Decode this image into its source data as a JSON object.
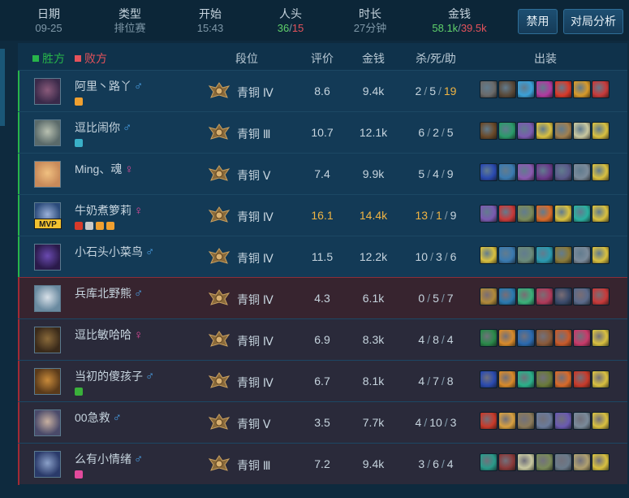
{
  "summary": {
    "date": {
      "label": "日期",
      "value": "09-25"
    },
    "type": {
      "label": "类型",
      "value": "排位赛"
    },
    "start": {
      "label": "开始",
      "value": "15:43"
    },
    "kills": {
      "label": "人头",
      "win": "36",
      "sep": "/",
      "lose": "15"
    },
    "duration": {
      "label": "时长",
      "value": "27分钟"
    },
    "gold": {
      "label": "金钱",
      "win": "58.1k",
      "sep": "/",
      "lose": "39.5k"
    }
  },
  "buttons": {
    "ban": "禁用",
    "analysis": "对局分析"
  },
  "table": {
    "win_label": "胜方",
    "lose_label": "败方",
    "headers": {
      "rank": "段位",
      "score": "评价",
      "gold": "金钱",
      "kda": "杀/死/助",
      "items": "出装"
    }
  },
  "colors": {
    "win": "#27b44a",
    "lose": "#e5525b",
    "highlight": "#f0b443",
    "male": "#4ba3ea",
    "female": "#e24a9c"
  },
  "players": [
    {
      "team": "win",
      "name": "阿里丶路丫",
      "gender": "♂",
      "rank": "青铜 Ⅳ",
      "score": "8.6",
      "gold": "9.4k",
      "k": "2",
      "d": "5",
      "a": "19",
      "hl": {
        "a": true
      },
      "mvp": false,
      "badges": [
        "#f0a030"
      ],
      "face": [
        "#3a2a4a",
        "#8a5a7a"
      ],
      "items": [
        "#6a6a6a",
        "#5a4a3a",
        "#3aa0d8",
        "#b03aa0",
        "#d83a2a",
        "#d89a2a",
        "#c83a3a"
      ]
    },
    {
      "team": "win",
      "name": "逗比闹你",
      "gender": "♂",
      "rank": "青铜 Ⅲ",
      "score": "10.7",
      "gold": "12.1k",
      "k": "6",
      "d": "2",
      "a": "5",
      "hl": {},
      "mvp": false,
      "badges": [
        "#3ab0c8"
      ],
      "face": [
        "#5a6a6a",
        "#b8c0b0"
      ],
      "items": [
        "#6a4a2a",
        "#2a9a6a",
        "#7a5ab0",
        "#d8c040",
        "#a08050",
        "#c8c8a0",
        "#d8c040"
      ]
    },
    {
      "team": "win",
      "name": "Ming、魂",
      "gender": "♀",
      "rank": "青铜 Ⅴ",
      "score": "7.4",
      "gold": "9.9k",
      "k": "5",
      "d": "4",
      "a": "9",
      "hl": {},
      "mvp": false,
      "badges": [],
      "face": [
        "#c88a5a",
        "#f0c080"
      ],
      "items": [
        "#2a4ab0",
        "#3a7ab0",
        "#8a5ab0",
        "#6a3a8a",
        "#5a5a8a",
        "#7a8a9a",
        "#d8c040"
      ]
    },
    {
      "team": "win",
      "name": "牛奶煮箩莉",
      "gender": "♀",
      "rank": "青铜 Ⅳ",
      "score": "16.1",
      "gold": "14.4k",
      "k": "13",
      "d": "1",
      "a": "9",
      "hl": {
        "score": true,
        "gold": true,
        "k": true,
        "d": true
      },
      "mvp": true,
      "badges": [
        "#d83a2a",
        "#c8c8c8",
        "#f0a030",
        "#f0a030"
      ],
      "face": [
        "#2a4a7a",
        "#9ab0d8"
      ],
      "items": [
        "#7a5ab0",
        "#c83a3a",
        "#7a8a5a",
        "#d86a2a",
        "#d8c040",
        "#2ab0a0",
        "#d8c040"
      ]
    },
    {
      "team": "win",
      "name": "小石头小菜鸟",
      "gender": "♂",
      "rank": "青铜 Ⅳ",
      "score": "11.5",
      "gold": "12.2k",
      "k": "10",
      "d": "3",
      "a": "6",
      "hl": {},
      "mvp": false,
      "badges": [],
      "face": [
        "#2a1a4a",
        "#6a4ab0"
      ],
      "items": [
        "#d8c040",
        "#3a7ab0",
        "#6a8a7a",
        "#2a9ab0",
        "#8a7a3a",
        "#7a8a9a",
        "#d8c040"
      ]
    },
    {
      "team": "lose",
      "name": "兵库北野熊",
      "gender": "♂",
      "rank": "青铜 Ⅳ",
      "score": "4.3",
      "gold": "6.1k",
      "k": "0",
      "d": "5",
      "a": "7",
      "hl": {},
      "mvp": false,
      "badges": [],
      "face": [
        "#6a8aa0",
        "#d8e0e8"
      ],
      "items": [
        "#b08a3a",
        "#2a7ab0",
        "#3ab07a",
        "#b03a5a",
        "#3a4a6a",
        "#5a6a8a",
        "#c83a3a"
      ]
    },
    {
      "team": "lose",
      "name": "逗比敏哈哈",
      "gender": "♀",
      "rank": "青铜 Ⅳ",
      "score": "6.9",
      "gold": "8.3k",
      "k": "4",
      "d": "8",
      "a": "4",
      "hl": {},
      "mvp": false,
      "badges": [],
      "face": [
        "#3a2a1a",
        "#8a6a3a"
      ],
      "items": [
        "#2a8a4a",
        "#d88a2a",
        "#2a6ab0",
        "#8a5a3a",
        "#c85a2a",
        "#c83a6a",
        "#d8c040"
      ]
    },
    {
      "team": "lose",
      "name": "当初的傻孩子",
      "gender": "♂",
      "rank": "青铜 Ⅳ",
      "score": "6.7",
      "gold": "8.1k",
      "k": "4",
      "d": "7",
      "a": "8",
      "hl": {},
      "mvp": false,
      "badges": [
        "#3ab03a"
      ],
      "face": [
        "#5a3a1a",
        "#c88a3a"
      ],
      "items": [
        "#2a4ab0",
        "#d88a2a",
        "#2ab08a",
        "#6a7a3a",
        "#d86a2a",
        "#c83a2a",
        "#d8c040"
      ]
    },
    {
      "team": "lose",
      "name": "00急救",
      "gender": "♂",
      "rank": "青铜 Ⅴ",
      "score": "3.5",
      "gold": "7.7k",
      "k": "4",
      "d": "10",
      "a": "3",
      "hl": {},
      "mvp": false,
      "badges": [],
      "face": [
        "#4a4a6a",
        "#c8b0a0"
      ],
      "items": [
        "#c83a2a",
        "#d8a040",
        "#8a7a5a",
        "#6a7a9a",
        "#6a5ab0",
        "#7a8a9a",
        "#d8c040"
      ]
    },
    {
      "team": "lose",
      "name": "么有小情绪",
      "gender": "♂",
      "rank": "青铜 Ⅲ",
      "score": "7.2",
      "gold": "9.4k",
      "k": "3",
      "d": "6",
      "a": "4",
      "hl": {},
      "mvp": false,
      "badges": [
        "#e24a9c"
      ],
      "face": [
        "#2a3a6a",
        "#8aa0c8"
      ],
      "items": [
        "#2a9a8a",
        "#8a3a3a",
        "#c8c8a0",
        "#7a8a5a",
        "#6a7a8a",
        "#b0a070",
        "#d8c040"
      ]
    }
  ]
}
